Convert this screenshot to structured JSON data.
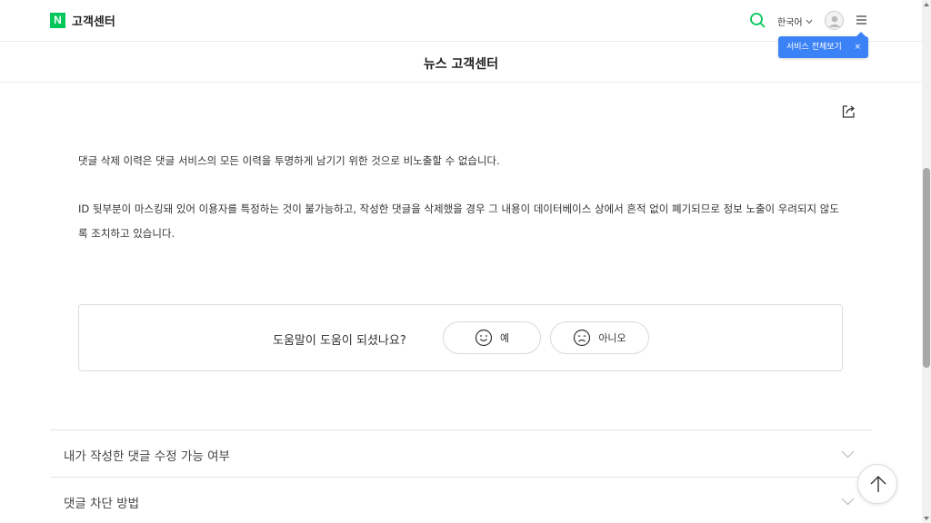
{
  "header": {
    "logo_letter": "N",
    "site_title": "고객센터",
    "language": "한국어",
    "tooltip": {
      "label": "서비스 전체보기",
      "close": "×"
    },
    "accent_color": "#03c75a",
    "tooltip_color": "#3b82f6"
  },
  "subheader": {
    "title": "뉴스 고객센터"
  },
  "content": {
    "paragraph_1": "댓글 삭제 이력은 댓글 서비스의 모든 이력을 투명하게 남기기 위한 것으로 비노출할 수 없습니다.",
    "paragraph_2": "ID 뒷부분이 마스킹돼 있어 이용자를 특정하는 것이 불가능하고, 작성한 댓글을 삭제했을 경우 그 내용이 데이터베이스 상에서 흔적 없이 폐기되므로 정보 노출이 우려되지 않도록 조치하고 있습니다."
  },
  "feedback": {
    "question": "도움말이 도움이 되셨나요?",
    "yes_label": "예",
    "no_label": "아니오"
  },
  "accordion": [
    {
      "label": "내가 작성한 댓글 수정 가능 여부"
    },
    {
      "label": "댓글 차단 방법"
    }
  ],
  "icons": {
    "search": "search-icon",
    "avatar": "user-icon",
    "menu": "menu-icon",
    "share": "share-icon",
    "smile": "smile-icon",
    "frown": "frown-icon",
    "chevron": "chevron-down-icon",
    "top": "arrow-up-icon"
  }
}
